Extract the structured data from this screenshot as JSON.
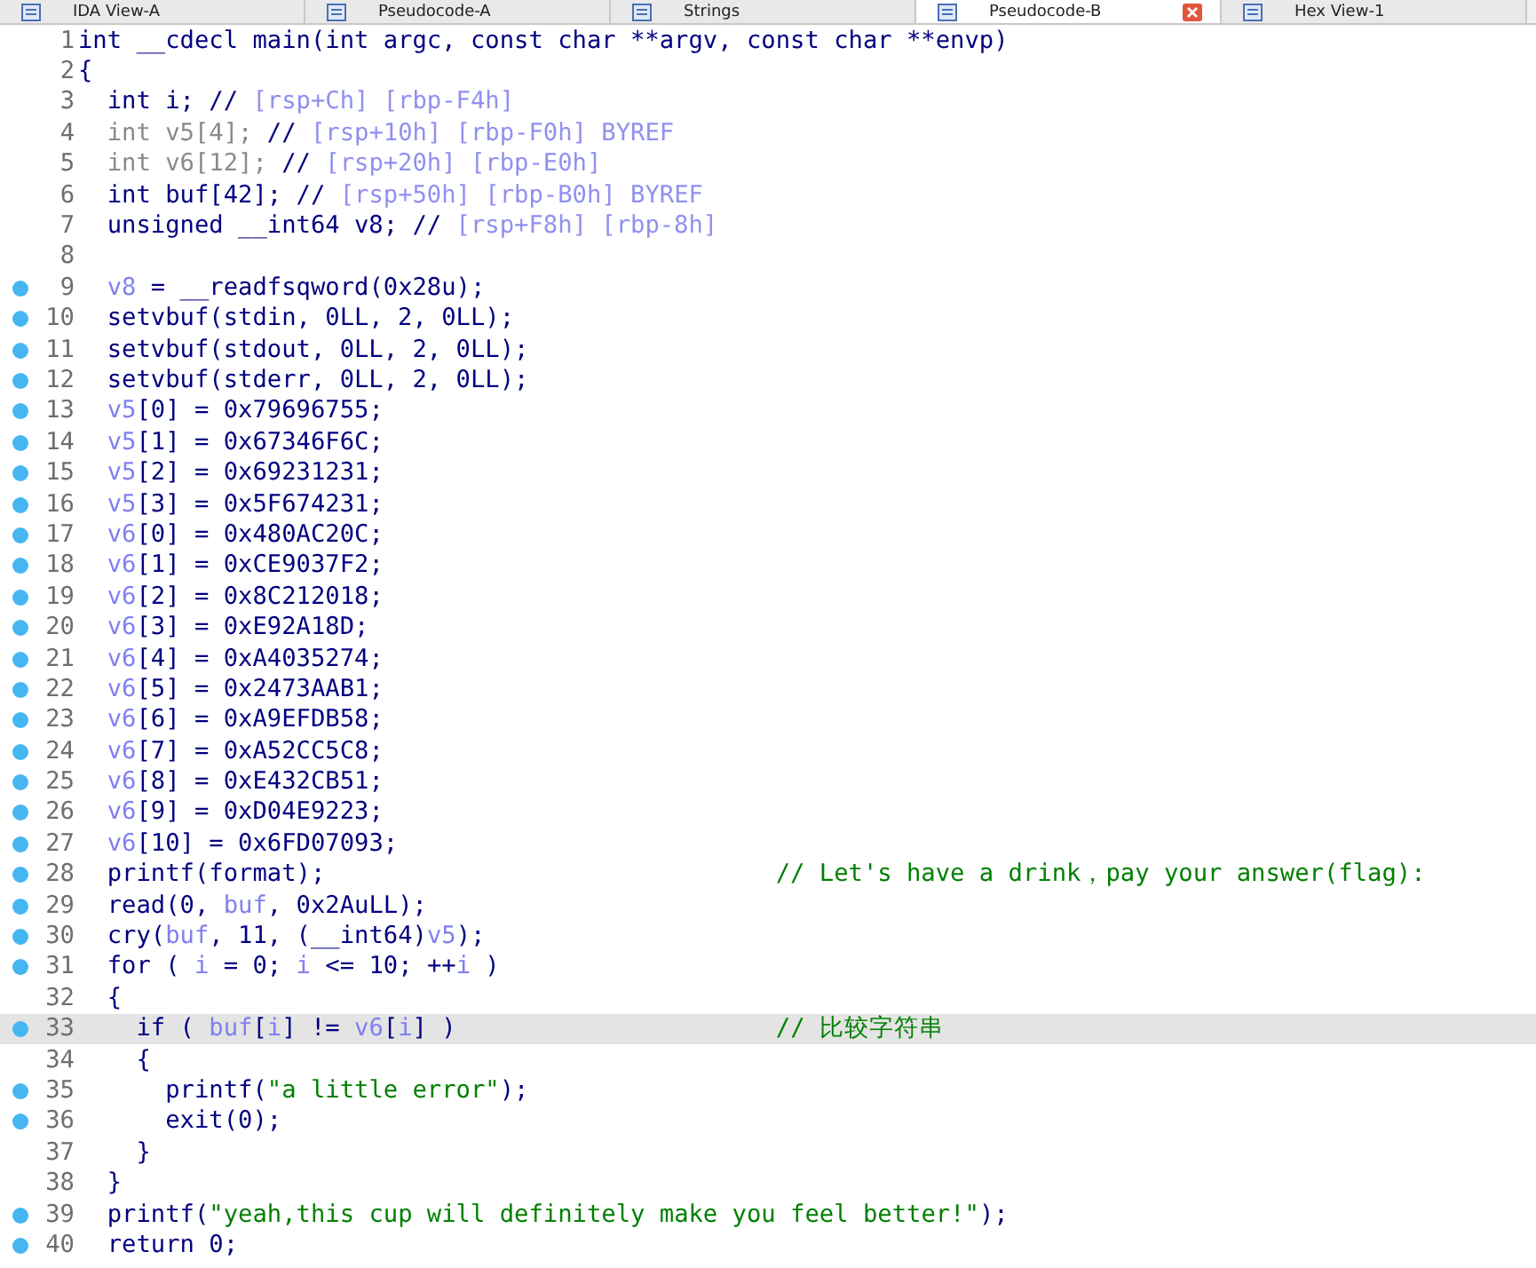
{
  "tabs": [
    {
      "label": "IDA View-A",
      "selected": false
    },
    {
      "label": "Pseudocode-A",
      "selected": false
    },
    {
      "label": "Strings",
      "selected": false
    },
    {
      "label": "Pseudocode-B",
      "selected": true
    },
    {
      "label": "Hex View-1",
      "selected": false
    }
  ],
  "code_lines": [
    {
      "number": "1",
      "breakpoint": false,
      "highlighted": false,
      "segments": [
        {
          "kind": "plain",
          "text": "int __cdecl main(int argc, const char **argv, const char **envp)"
        }
      ]
    },
    {
      "number": "2",
      "breakpoint": false,
      "highlighted": false,
      "segments": [
        {
          "kind": "plain",
          "text": "{"
        }
      ]
    },
    {
      "number": "3",
      "breakpoint": false,
      "highlighted": false,
      "segments": [
        {
          "kind": "plain",
          "text": "  int i; // "
        },
        {
          "kind": "addr",
          "text": "[rsp+Ch] [rbp-F4h]"
        }
      ]
    },
    {
      "number": "4",
      "breakpoint": false,
      "highlighted": false,
      "segments": [
        {
          "kind": "muted",
          "text": "  int v5[4]; "
        },
        {
          "kind": "plain",
          "text": "// "
        },
        {
          "kind": "addr",
          "text": "[rsp+10h] [rbp-F0h] BYREF"
        }
      ]
    },
    {
      "number": "5",
      "breakpoint": false,
      "highlighted": false,
      "segments": [
        {
          "kind": "muted",
          "text": "  int v6[12]; "
        },
        {
          "kind": "plain",
          "text": "// "
        },
        {
          "kind": "addr",
          "text": "[rsp+20h] [rbp-E0h]"
        }
      ]
    },
    {
      "number": "6",
      "breakpoint": false,
      "highlighted": false,
      "segments": [
        {
          "kind": "plain",
          "text": "  int buf[42]; // "
        },
        {
          "kind": "addr",
          "text": "[rsp+50h] [rbp-B0h] BYREF"
        }
      ]
    },
    {
      "number": "7",
      "breakpoint": false,
      "highlighted": false,
      "segments": [
        {
          "kind": "plain",
          "text": "  unsigned __int64 v8; // "
        },
        {
          "kind": "addr",
          "text": "[rsp+F8h] [rbp-8h]"
        }
      ]
    },
    {
      "number": "8",
      "breakpoint": false,
      "highlighted": false
    },
    {
      "number": "9",
      "breakpoint": true,
      "highlighted": false,
      "segments": [
        {
          "kind": "var",
          "text": "  v8"
        },
        {
          "kind": "plain",
          "text": " = __readfsqword(0x28u);"
        }
      ]
    },
    {
      "number": "10",
      "breakpoint": true,
      "highlighted": false,
      "segments": [
        {
          "kind": "plain",
          "text": "  setvbuf(stdin, 0LL, 2, 0LL);"
        }
      ]
    },
    {
      "number": "11",
      "breakpoint": true,
      "highlighted": false,
      "segments": [
        {
          "kind": "plain",
          "text": "  setvbuf(stdout, 0LL, 2, 0LL);"
        }
      ]
    },
    {
      "number": "12",
      "breakpoint": true,
      "highlighted": false,
      "segments": [
        {
          "kind": "plain",
          "text": "  setvbuf(stderr, 0LL, 2, 0LL);"
        }
      ]
    },
    {
      "number": "13",
      "breakpoint": true,
      "highlighted": false,
      "segments": [
        {
          "kind": "var",
          "text": "  v5"
        },
        {
          "kind": "plain",
          "text": "[0] = 0x79696755;"
        }
      ]
    },
    {
      "number": "14",
      "breakpoint": true,
      "highlighted": false,
      "segments": [
        {
          "kind": "var",
          "text": "  v5"
        },
        {
          "kind": "plain",
          "text": "[1] = 0x67346F6C;"
        }
      ]
    },
    {
      "number": "15",
      "breakpoint": true,
      "highlighted": false,
      "segments": [
        {
          "kind": "var",
          "text": "  v5"
        },
        {
          "kind": "plain",
          "text": "[2] = 0x69231231;"
        }
      ]
    },
    {
      "number": "16",
      "breakpoint": true,
      "highlighted": false,
      "segments": [
        {
          "kind": "var",
          "text": "  v5"
        },
        {
          "kind": "plain",
          "text": "[3] = 0x5F674231;"
        }
      ]
    },
    {
      "number": "17",
      "breakpoint": true,
      "highlighted": false,
      "segments": [
        {
          "kind": "var",
          "text": "  v6"
        },
        {
          "kind": "plain",
          "text": "[0] = 0x480AC20C;"
        }
      ]
    },
    {
      "number": "18",
      "breakpoint": true,
      "highlighted": false,
      "segments": [
        {
          "kind": "var",
          "text": "  v6"
        },
        {
          "kind": "plain",
          "text": "[1] = 0xCE9037F2;"
        }
      ]
    },
    {
      "number": "19",
      "breakpoint": true,
      "highlighted": false,
      "segments": [
        {
          "kind": "var",
          "text": "  v6"
        },
        {
          "kind": "plain",
          "text": "[2] = 0x8C212018;"
        }
      ]
    },
    {
      "number": "20",
      "breakpoint": true,
      "highlighted": false,
      "segments": [
        {
          "kind": "var",
          "text": "  v6"
        },
        {
          "kind": "plain",
          "text": "[3] = 0xE92A18D;"
        }
      ]
    },
    {
      "number": "21",
      "breakpoint": true,
      "highlighted": false,
      "segments": [
        {
          "kind": "var",
          "text": "  v6"
        },
        {
          "kind": "plain",
          "text": "[4] = 0xA4035274;"
        }
      ]
    },
    {
      "number": "22",
      "breakpoint": true,
      "highlighted": false,
      "segments": [
        {
          "kind": "var",
          "text": "  v6"
        },
        {
          "kind": "plain",
          "text": "[5] = 0x2473AAB1;"
        }
      ]
    },
    {
      "number": "23",
      "breakpoint": true,
      "highlighted": false,
      "segments": [
        {
          "kind": "var",
          "text": "  v6"
        },
        {
          "kind": "plain",
          "text": "[6] = 0xA9EFDB58;"
        }
      ]
    },
    {
      "number": "24",
      "breakpoint": true,
      "highlighted": false,
      "segments": [
        {
          "kind": "var",
          "text": "  v6"
        },
        {
          "kind": "plain",
          "text": "[7] = 0xA52CC5C8;"
        }
      ]
    },
    {
      "number": "25",
      "breakpoint": true,
      "highlighted": false,
      "segments": [
        {
          "kind": "var",
          "text": "  v6"
        },
        {
          "kind": "plain",
          "text": "[8] = 0xE432CB51;"
        }
      ]
    },
    {
      "number": "26",
      "breakpoint": true,
      "highlighted": false,
      "segments": [
        {
          "kind": "var",
          "text": "  v6"
        },
        {
          "kind": "plain",
          "text": "[9] = 0xD04E9223;"
        }
      ]
    },
    {
      "number": "27",
      "breakpoint": true,
      "highlighted": false,
      "segments": [
        {
          "kind": "var",
          "text": "  v6"
        },
        {
          "kind": "plain",
          "text": "[10] = 0x6FD07093;"
        }
      ]
    },
    {
      "number": "28",
      "breakpoint": true,
      "highlighted": false,
      "segments": [
        {
          "kind": "plain",
          "text": "  printf(format);                               "
        },
        {
          "kind": "comment",
          "text": "// Let's have a drink，pay your answer(flag):"
        }
      ]
    },
    {
      "number": "29",
      "breakpoint": true,
      "highlighted": false,
      "segments": [
        {
          "kind": "plain",
          "text": "  read(0, "
        },
        {
          "kind": "var",
          "text": "buf"
        },
        {
          "kind": "plain",
          "text": ", 0x2AuLL);"
        }
      ]
    },
    {
      "number": "30",
      "breakpoint": true,
      "highlighted": false,
      "segments": [
        {
          "kind": "plain",
          "text": "  cry("
        },
        {
          "kind": "var",
          "text": "buf"
        },
        {
          "kind": "plain",
          "text": ", 11, (__int64)"
        },
        {
          "kind": "var",
          "text": "v5"
        },
        {
          "kind": "plain",
          "text": ");"
        }
      ]
    },
    {
      "number": "31",
      "breakpoint": true,
      "highlighted": false,
      "segments": [
        {
          "kind": "plain",
          "text": "  for ( "
        },
        {
          "kind": "var",
          "text": "i"
        },
        {
          "kind": "plain",
          "text": " = 0; "
        },
        {
          "kind": "var",
          "text": "i"
        },
        {
          "kind": "plain",
          "text": " <= 10; ++"
        },
        {
          "kind": "var",
          "text": "i"
        },
        {
          "kind": "plain",
          "text": " )"
        }
      ]
    },
    {
      "number": "32",
      "breakpoint": false,
      "highlighted": false,
      "segments": [
        {
          "kind": "plain",
          "text": "  {"
        }
      ]
    },
    {
      "number": "33",
      "breakpoint": true,
      "highlighted": true,
      "segments": [
        {
          "kind": "plain",
          "text": "    if ( "
        },
        {
          "kind": "var",
          "text": "buf"
        },
        {
          "kind": "plain",
          "text": "["
        },
        {
          "kind": "var",
          "text": "i"
        },
        {
          "kind": "plain",
          "text": "] != "
        },
        {
          "kind": "var",
          "text": "v6"
        },
        {
          "kind": "plain",
          "text": "["
        },
        {
          "kind": "var",
          "text": "i"
        },
        {
          "kind": "plain",
          "text": "] )                      "
        },
        {
          "kind": "comment",
          "text": "// 比较字符串"
        }
      ]
    },
    {
      "number": "34",
      "breakpoint": false,
      "highlighted": false,
      "segments": [
        {
          "kind": "plain",
          "text": "    {"
        }
      ]
    },
    {
      "number": "35",
      "breakpoint": true,
      "highlighted": false,
      "segments": [
        {
          "kind": "plain",
          "text": "      printf("
        },
        {
          "kind": "string",
          "text": "\"a little error\""
        },
        {
          "kind": "plain",
          "text": ");"
        }
      ]
    },
    {
      "number": "36",
      "breakpoint": true,
      "highlighted": false,
      "segments": [
        {
          "kind": "plain",
          "text": "      exit(0);"
        }
      ]
    },
    {
      "number": "37",
      "breakpoint": false,
      "highlighted": false,
      "segments": [
        {
          "kind": "plain",
          "text": "    }"
        }
      ]
    },
    {
      "number": "38",
      "breakpoint": false,
      "highlighted": false,
      "segments": [
        {
          "kind": "plain",
          "text": "  }"
        }
      ]
    },
    {
      "number": "39",
      "breakpoint": true,
      "highlighted": false,
      "segments": [
        {
          "kind": "plain",
          "text": "  printf("
        },
        {
          "kind": "string",
          "text": "\"yeah,this cup will definitely make you feel better!\""
        },
        {
          "kind": "plain",
          "text": ");"
        }
      ]
    },
    {
      "number": "40",
      "breakpoint": true,
      "highlighted": false,
      "segments": [
        {
          "kind": "plain",
          "text": "  return 0;"
        }
      ]
    }
  ]
}
